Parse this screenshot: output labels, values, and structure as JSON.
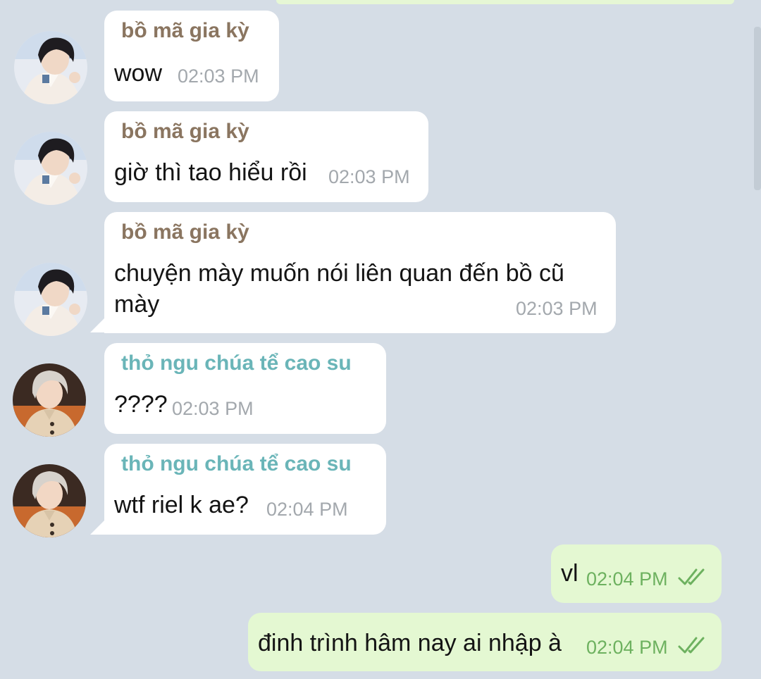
{
  "colors": {
    "background": "#d5dde6",
    "incoming_bubble": "#ffffff",
    "outgoing_bubble": "#e4f8d2",
    "sender_a": "#8a7560",
    "sender_b": "#6ab5b8",
    "time_incoming": "#a3a8ad",
    "time_outgoing": "#6db15f"
  },
  "messages": [
    {
      "direction": "in",
      "sender": "bồ mã gia kỳ",
      "text": "wow",
      "time": "02:03 PM"
    },
    {
      "direction": "in",
      "sender": "bồ mã gia kỳ",
      "text": "giờ thì tao hiểu rồi",
      "time": "02:03 PM"
    },
    {
      "direction": "in",
      "sender": "bồ mã gia kỳ",
      "text_line1": "chuyện mày muốn nói liên quan đến bồ cũ",
      "text_line2": "mày",
      "time": "02:03 PM"
    },
    {
      "direction": "in",
      "sender": "thỏ ngu chúa tể cao su",
      "text": "????",
      "time": "02:03 PM"
    },
    {
      "direction": "in",
      "sender": "thỏ ngu chúa tể cao su",
      "text": "wtf riel k ae?",
      "time": "02:04 PM"
    },
    {
      "direction": "out",
      "text": "vl",
      "time": "02:04 PM",
      "status_icon": "double-check-icon"
    },
    {
      "direction": "out",
      "text": "đinh trình hâm nay ai nhập à",
      "time": "02:04 PM",
      "status_icon": "double-check-icon"
    }
  ]
}
